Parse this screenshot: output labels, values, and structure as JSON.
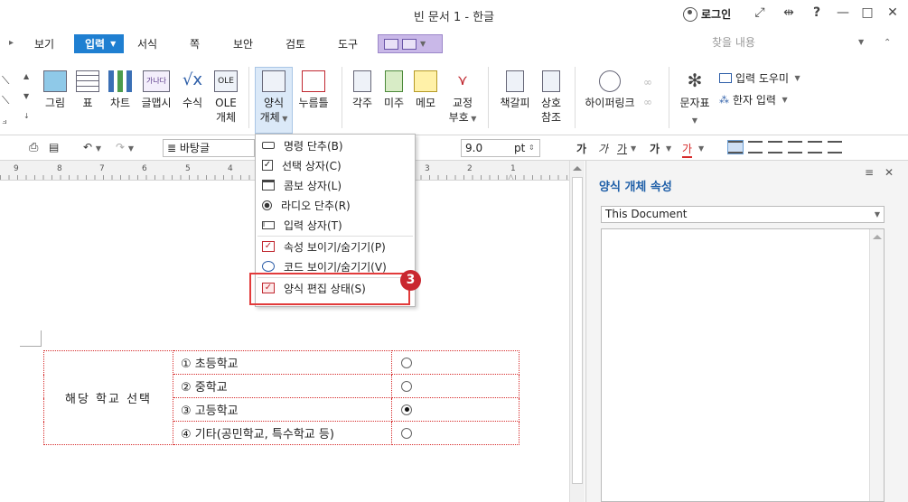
{
  "window": {
    "title": "빈 문서 1 - 한글",
    "login_label": "로그인",
    "help_label": "?"
  },
  "menu": {
    "items": [
      "보기",
      "입력",
      "서식",
      "쪽",
      "보안",
      "검토",
      "도구"
    ],
    "active": "입력",
    "search_placeholder": "찾을 내용"
  },
  "ribbon": {
    "buttons": [
      {
        "label": "그림"
      },
      {
        "label": "표"
      },
      {
        "label": "차트"
      },
      {
        "label": "글맵시"
      },
      {
        "label": "수식"
      },
      {
        "label": "OLE",
        "label2": "개체",
        "icon_text": "OLE"
      },
      {
        "label": "양식",
        "label2": "개체"
      },
      {
        "label": "누름틀"
      },
      {
        "label": "각주"
      },
      {
        "label": "미주"
      },
      {
        "label": "메모"
      },
      {
        "label": "교정",
        "label2": "부호"
      },
      {
        "label": "책갈피"
      },
      {
        "label": "상호",
        "label2": "참조"
      },
      {
        "label": "하이퍼링크"
      },
      {
        "label": "문자표"
      }
    ],
    "side_items": [
      "입력 도우미",
      "한자 입력"
    ],
    "geulmapsi_icon_text": "가나다"
  },
  "format_bar": {
    "style_value": "바탕글",
    "font_size": "9.0",
    "unit": "pt",
    "font_style_labels": [
      "가",
      "가",
      "가",
      "가",
      "가"
    ]
  },
  "ruler": {
    "numbers": [
      "9",
      "8",
      "7",
      "6",
      "5",
      "4",
      "3",
      "2",
      "1"
    ]
  },
  "dropdown": {
    "items": [
      {
        "label": "명령 단추(B)",
        "icon": "command-button-icon"
      },
      {
        "label": "선택 상자(C)",
        "icon": "checkbox-icon"
      },
      {
        "label": "콤보 상자(L)",
        "icon": "combo-box-icon"
      },
      {
        "label": "라디오 단추(R)",
        "icon": "radio-button-icon"
      },
      {
        "label": "입력 상자(T)",
        "icon": "input-box-icon"
      },
      {
        "label": "속성 보이기/숨기기(P)",
        "icon": "properties-icon"
      },
      {
        "label": "코드 보이기/숨기기(V)",
        "icon": "code-icon"
      },
      {
        "label": "양식 편집 상태(S)",
        "icon": "form-edit-icon"
      }
    ],
    "step_number": "3",
    "highlight_color": "#e23b3b"
  },
  "form_table": {
    "label": "해당 학교 선택",
    "options": [
      {
        "num": "①",
        "text": "초등학교",
        "selected": false
      },
      {
        "num": "②",
        "text": "중학교",
        "selected": false
      },
      {
        "num": "③",
        "text": "고등학교",
        "selected": true
      },
      {
        "num": "④",
        "text": "기타(공민학교, 특수학교 등)",
        "selected": false
      }
    ]
  },
  "side_panel": {
    "title": "양식 개체 속성",
    "select_value": "This Document"
  },
  "colors": {
    "accent": "#1f7fd1",
    "panel_title": "#1f5fa8",
    "table_border": "#d62b2b",
    "badge": "#c9272f"
  }
}
